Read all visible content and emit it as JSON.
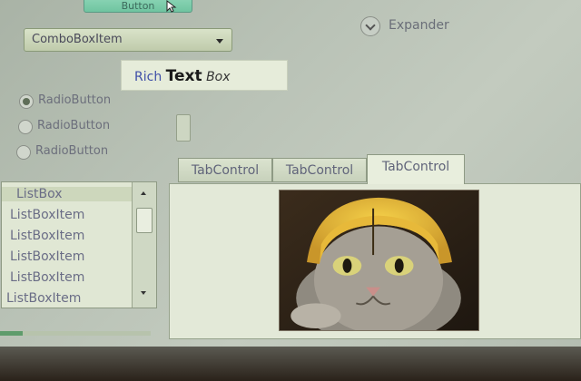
{
  "button": {
    "label": "Button"
  },
  "combobox": {
    "selected": "ComboBoxItem"
  },
  "expander": {
    "label": "Expander"
  },
  "richtextbox": {
    "word1": "Rich",
    "word2": "Text",
    "word3": "Box"
  },
  "radios": [
    {
      "label": "RadioButton",
      "checked": true
    },
    {
      "label": "RadioButton",
      "checked": false
    },
    {
      "label": "RadioButton",
      "checked": false
    }
  ],
  "tabs": [
    {
      "label": "TabControl",
      "active": false
    },
    {
      "label": "TabControl",
      "active": false
    },
    {
      "label": "TabControl",
      "active": true
    }
  ],
  "listbox": {
    "items": [
      "ListBox",
      "ListBoxItem",
      "ListBoxItem",
      "ListBoxItem",
      "ListBoxItem",
      "ListBoxItem"
    ],
    "selected_index": 0
  },
  "progress": {
    "value": 0.15
  },
  "colors": {
    "accent": "#6fc4a0",
    "progress_fill": "#5f9c6c"
  },
  "icons": [
    "cursor-icon",
    "chevron-down-icon",
    "expander-chevron-icon",
    "scroll-up-icon",
    "scroll-down-icon"
  ]
}
